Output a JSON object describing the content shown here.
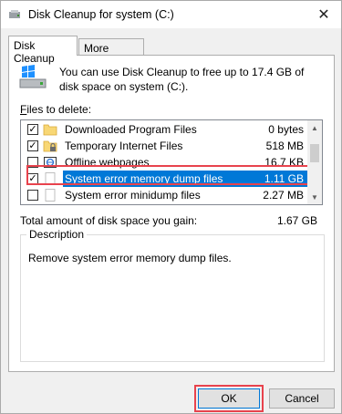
{
  "window": {
    "title": "Disk Cleanup for system (C:)",
    "close_glyph": "✕"
  },
  "tabs": [
    {
      "label": "Disk Cleanup",
      "active": true
    },
    {
      "label": "More Options",
      "active": false
    }
  ],
  "intro_text": "You can use Disk Cleanup to free up to 17.4 GB of disk space on system (C:).",
  "files_label": {
    "mnemonic": "F",
    "rest": "iles to delete:"
  },
  "files": [
    {
      "name": "Downloaded Program Files",
      "size": "0 bytes",
      "checked": true,
      "icon": "folder-icon"
    },
    {
      "name": "Temporary Internet Files",
      "size": "518 MB",
      "checked": true,
      "icon": "folder-lock-icon"
    },
    {
      "name": "Offline webpages",
      "size": "16.7 KB",
      "checked": false,
      "icon": "offline-webpage-icon"
    },
    {
      "name": "System error memory dump files",
      "size": "1.11 GB",
      "checked": true,
      "selected": true,
      "icon": "blank-file-icon"
    },
    {
      "name": "System error minidump files",
      "size": "2.27 MB",
      "checked": false,
      "icon": "blank-file-icon"
    }
  ],
  "total_label": "Total amount of disk space you gain:",
  "total_value": "1.67 GB",
  "description": {
    "legend": "Description",
    "text": "Remove system error memory dump files."
  },
  "buttons": {
    "ok": "OK",
    "cancel": "Cancel"
  },
  "colors": {
    "selection": "#0078d7",
    "highlight": "#e8434d",
    "folder": "#f8d775"
  }
}
